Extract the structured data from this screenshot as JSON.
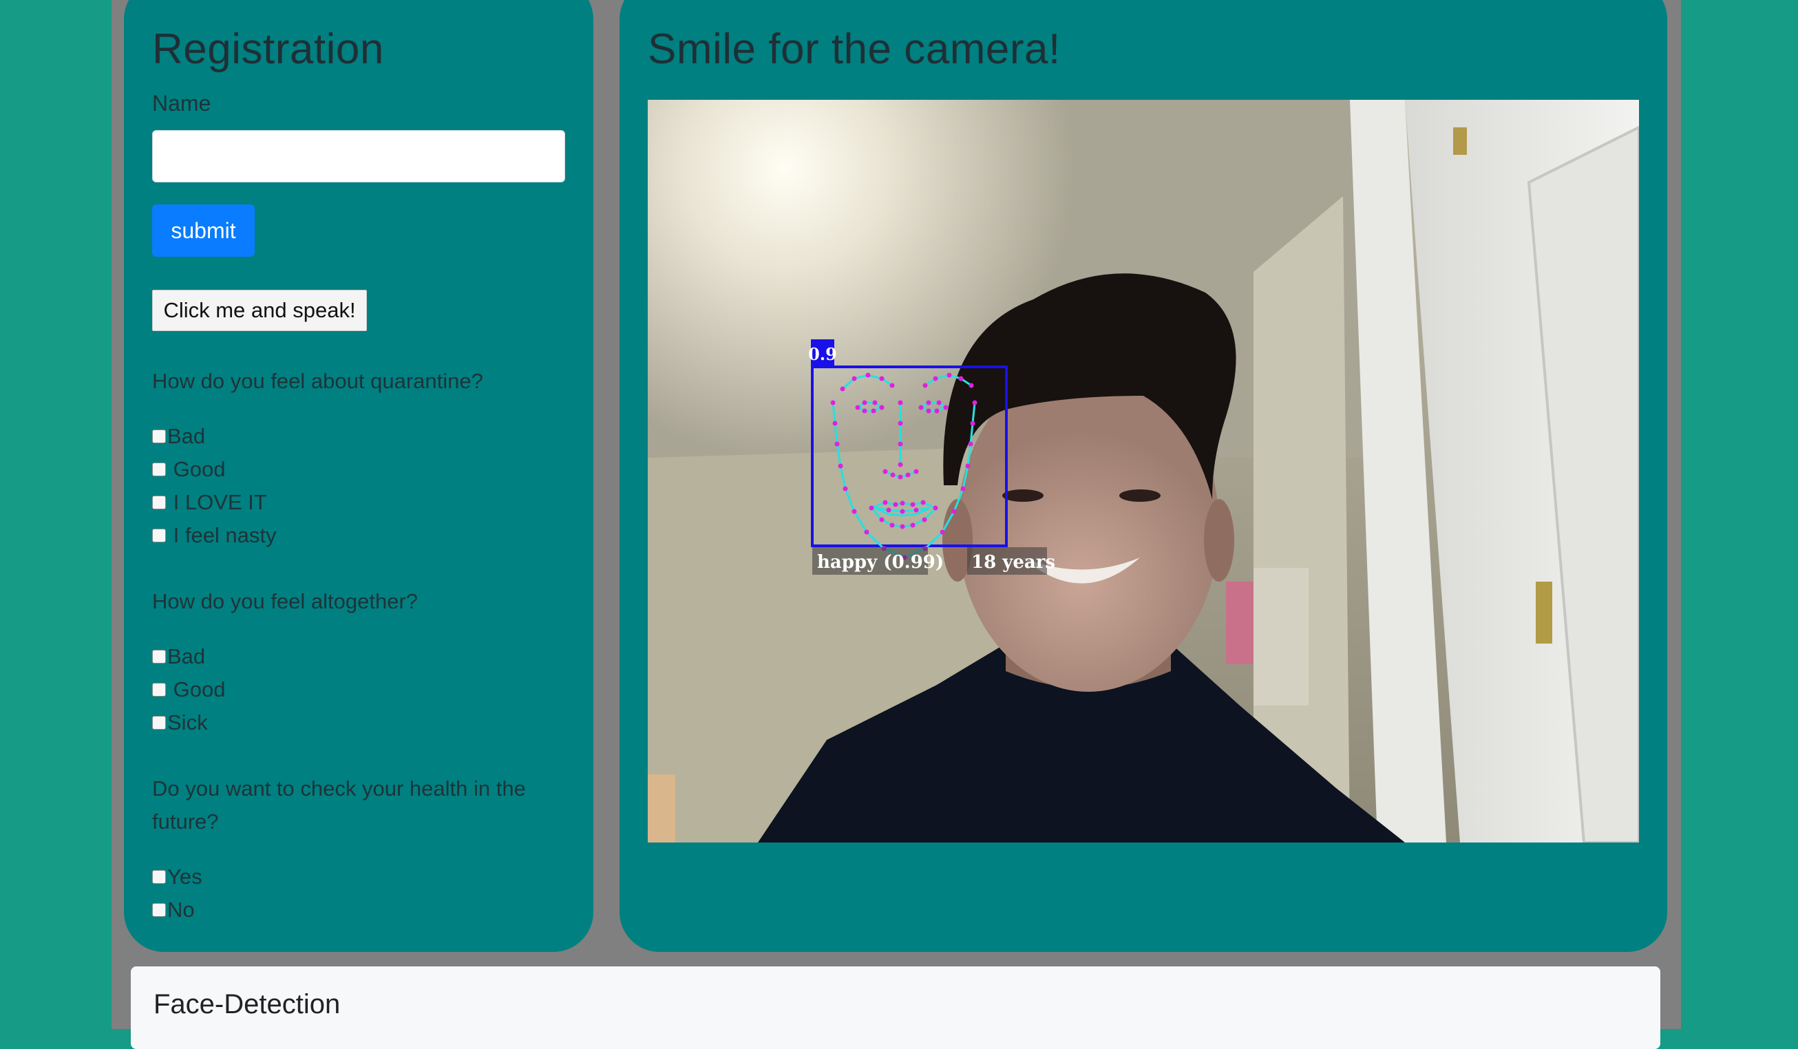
{
  "registration": {
    "title": "Registration",
    "name_label": "Name",
    "name_value": "",
    "submit_label": "submit",
    "speak_label": "Click me and speak!"
  },
  "questions": [
    {
      "text": "How do you feel about quarantine?",
      "options": [
        "Bad",
        " Good",
        " I LOVE IT",
        " I feel nasty"
      ]
    },
    {
      "text": "How do you feel altogether?",
      "options": [
        "Bad",
        " Good",
        "Sick"
      ]
    },
    {
      "text": "Do you want to check your health in the future?",
      "options": [
        "Yes",
        "No"
      ]
    }
  ],
  "camera": {
    "title": "Smile for the camera!",
    "detection_score": "0.9",
    "expression_label": "happy (0.99)",
    "age_label": "18 years"
  },
  "footer": {
    "title": "Face-Detection"
  },
  "colors": {
    "page_bg": "#169b86",
    "frame_bg": "#808080",
    "panel_bg": "#008080",
    "submit_bg": "#0a7cff",
    "box_color": "#1a10e8",
    "landmark_line": "#26e0e0",
    "landmark_point": "#e020e0"
  }
}
